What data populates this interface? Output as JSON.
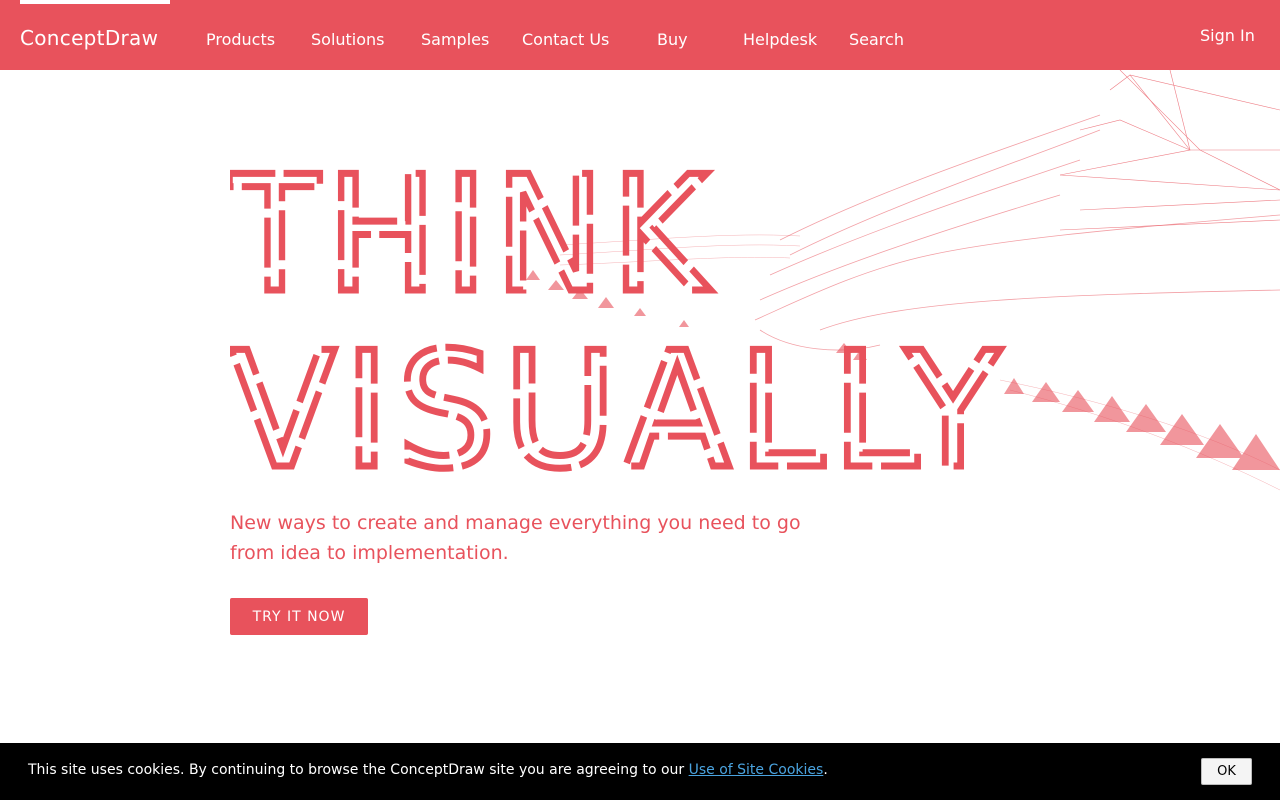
{
  "header": {
    "logo": "ConceptDraw",
    "nav": [
      "Products",
      "Solutions",
      "Samples",
      "Contact Us",
      "Buy",
      "Helpdesk",
      "Search"
    ],
    "sign_in": "Sign In"
  },
  "hero": {
    "title_line1": "THINK",
    "title_line2": "VISUALLY",
    "description": "New ways to create and manage everything you need to go from idea to implementation.",
    "cta": "TRY IT NOW"
  },
  "cookie": {
    "text_before": "This site uses cookies. By continuing to browse the ConceptDraw site you are agreeing to our ",
    "link": "Use of Site Cookies",
    "text_after": ".",
    "ok": "OK"
  },
  "colors": {
    "brand": "#e8525c",
    "cookie_bar": "#000000",
    "link": "#4aa3df"
  }
}
